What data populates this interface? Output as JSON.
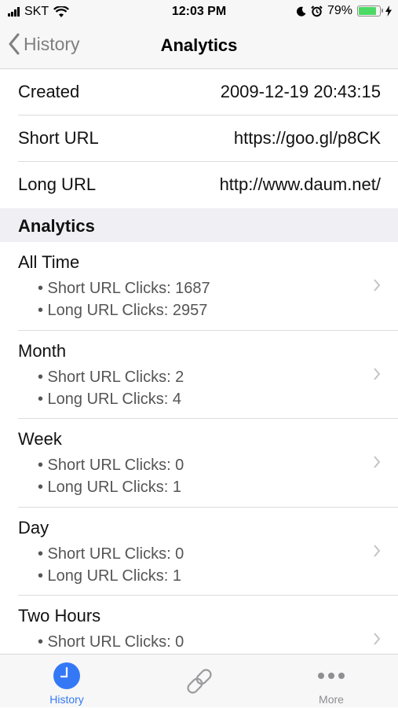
{
  "status_bar": {
    "carrier": "SKT",
    "time": "12:03 PM",
    "battery_percent": "79%",
    "battery_level": 0.79,
    "icons": [
      "signal-icon",
      "wifi-icon",
      "moon-icon",
      "alarm-icon",
      "battery-icon",
      "charging-icon"
    ]
  },
  "nav": {
    "back_label": "History",
    "title": "Analytics"
  },
  "details": [
    {
      "label": "Created",
      "value": "2009-12-19  20:43:15"
    },
    {
      "label": "Short URL",
      "value": "https://goo.gl/p8CK"
    },
    {
      "label": "Long URL",
      "value": "http://www.daum.net/"
    }
  ],
  "analytics": {
    "header": "Analytics",
    "rows": [
      {
        "title": "All Time",
        "short": "• Short URL Clicks: 1687",
        "long": "• Long URL Clicks: 2957"
      },
      {
        "title": "Month",
        "short": "• Short URL Clicks: 2",
        "long": "• Long URL Clicks: 4"
      },
      {
        "title": "Week",
        "short": "• Short URL Clicks: 0",
        "long": "• Long URL Clicks: 1"
      },
      {
        "title": "Day",
        "short": "• Short URL Clicks: 0",
        "long": "• Long URL Clicks: 1"
      },
      {
        "title": "Two Hours",
        "short": "• Short URL Clicks: 0",
        "long": ""
      }
    ]
  },
  "tabbar": {
    "tabs": [
      {
        "label": "History",
        "icon": "clock-icon",
        "active": true
      },
      {
        "label": "",
        "icon": "link-icon",
        "active": false
      },
      {
        "label": "More",
        "icon": "more-icon",
        "active": false
      }
    ],
    "accent": "#3478f6",
    "inactive": "#8e8e93"
  }
}
